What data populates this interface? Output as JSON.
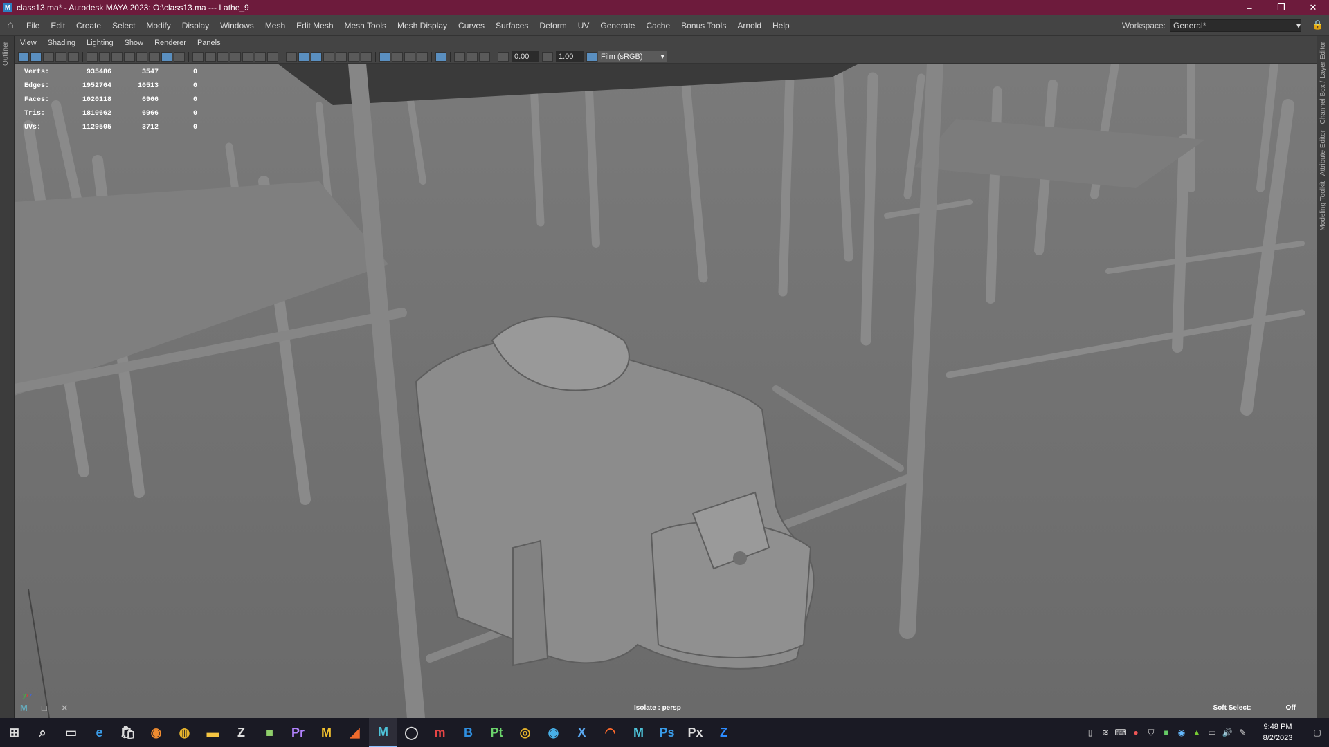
{
  "window": {
    "title": "class13.ma* - Autodesk MAYA 2023: O:\\class13.ma  ---  Lathe_9",
    "minimize": "–",
    "restore": "❐",
    "close": "✕"
  },
  "menus": [
    "File",
    "Edit",
    "Create",
    "Select",
    "Modify",
    "Display",
    "Windows",
    "Mesh",
    "Edit Mesh",
    "Mesh Tools",
    "Mesh Display",
    "Curves",
    "Surfaces",
    "Deform",
    "UV",
    "Generate",
    "Cache",
    "Bonus Tools",
    "Arnold",
    "Help"
  ],
  "workspace": {
    "label": "Workspace:",
    "value": "General*"
  },
  "side_labels": {
    "left": "Outliner",
    "right": [
      "Channel Box / Layer Editor",
      "Attribute Editor",
      "Modeling Toolkit"
    ]
  },
  "panel_menus": [
    "View",
    "Shading",
    "Lighting",
    "Show",
    "Renderer",
    "Panels"
  ],
  "toolbar": {
    "exposure": "0.00",
    "gamma": "1.00",
    "colorspace": "Film (sRGB)"
  },
  "hud": [
    {
      "label": "Verts:",
      "v1": "935486",
      "v2": "3547",
      "v3": "0"
    },
    {
      "label": "Edges:",
      "v1": "1952764",
      "v2": "10513",
      "v3": "0"
    },
    {
      "label": "Faces:",
      "v1": "1020118",
      "v2": "6966",
      "v3": "0"
    },
    {
      "label": "Tris:",
      "v1": "1810662",
      "v2": "6966",
      "v3": "0"
    },
    {
      "label": "UVs:",
      "v1": "1129505",
      "v2": "3712",
      "v3": "0"
    }
  ],
  "viewport": {
    "isolate": "Isolate : persp",
    "soft_select_label": "Soft Select:",
    "soft_select_value": "Off"
  },
  "taskbar": {
    "icons": [
      "windows-start",
      "search",
      "task-view",
      "edge",
      "store",
      "blender",
      "chrome",
      "file-explorer",
      "zbrush",
      "substance-designer",
      "premiere",
      "marmoset",
      "substance-3d",
      "maya",
      "quixel",
      "mudbox",
      "substance-b",
      "substance-painter",
      "unity-globe",
      "steam-like",
      "x-app",
      "houdini",
      "maya-2",
      "photoshop",
      "pixel",
      "zoom"
    ],
    "time": "9:48 PM",
    "date": "8/2/2023"
  }
}
